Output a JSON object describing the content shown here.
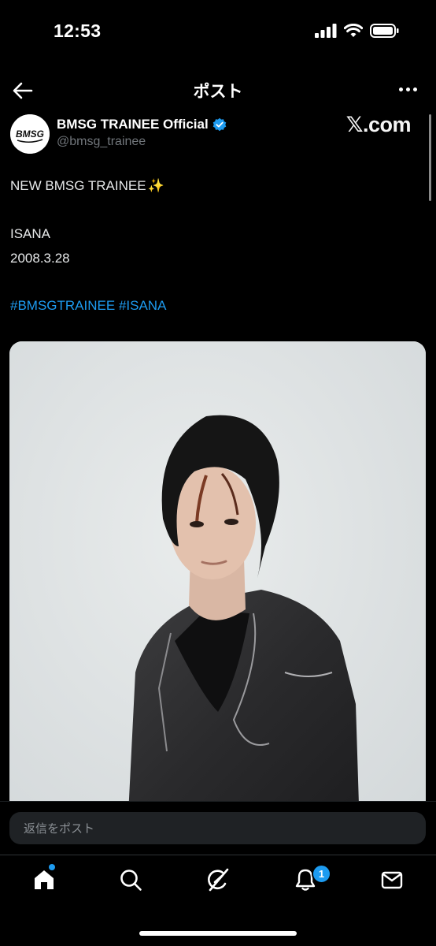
{
  "status_bar": {
    "time": "12:53"
  },
  "header": {
    "title": "ポスト"
  },
  "author": {
    "name": "BMSG TRAINEE Official",
    "handle": "@bmsg_trainee",
    "avatar_text": "BMSG"
  },
  "watermark": "𝕏.com",
  "post": {
    "line1": "NEW BMSG TRAINEE",
    "sparkle": "✨",
    "line2": "ISANA",
    "line3": "2008.3.28",
    "hashtag1": "#BMSGTRAINEE",
    "hashtag2": "#ISANA"
  },
  "reply": {
    "placeholder": "返信をポスト"
  },
  "tabbar": {
    "tabs": [
      "home-icon",
      "search-icon",
      "grok-icon",
      "bell-icon",
      "mail-icon"
    ],
    "notification_count": "1"
  },
  "colors": {
    "accent": "#1d9bf0",
    "background": "#000000",
    "muted": "#71767b"
  }
}
